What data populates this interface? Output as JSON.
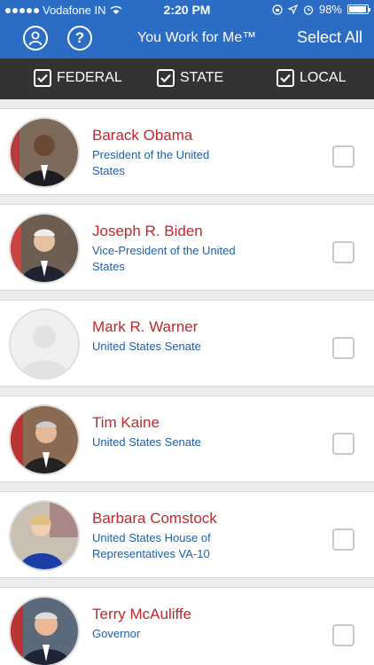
{
  "status_bar": {
    "carrier": "Vodafone IN",
    "time": "2:20 PM",
    "battery": "98%",
    "battery_level": 0.98
  },
  "header": {
    "title": "You Work for Me™",
    "select_all": "Select All",
    "help_glyph": "?"
  },
  "filters": [
    {
      "label": "FEDERAL",
      "checked": true
    },
    {
      "label": "STATE",
      "checked": true
    },
    {
      "label": "LOCAL",
      "checked": true
    }
  ],
  "officials": [
    {
      "name": "Barack Obama",
      "office": "President of the United States",
      "photo": "official-photo",
      "selected": false
    },
    {
      "name": "Joseph R. Biden",
      "office": "Vice-President of the United States",
      "photo": "official-photo",
      "selected": false
    },
    {
      "name": "Mark R. Warner",
      "office": "United States Senate",
      "photo": "placeholder-avatar",
      "selected": false
    },
    {
      "name": "Tim Kaine",
      "office": "United States Senate",
      "photo": "official-photo",
      "selected": false
    },
    {
      "name": "Barbara Comstock",
      "office": "United States House of Representatives VA-10",
      "photo": "official-photo",
      "selected": false
    },
    {
      "name": "Terry McAuliffe",
      "office": "Governor",
      "photo": "official-photo",
      "selected": false
    }
  ],
  "colors": {
    "brand_blue": "#2b6cc4",
    "filter_bar": "#333333",
    "name_red": "#c1272d",
    "office_blue": "#1f5fa8"
  }
}
